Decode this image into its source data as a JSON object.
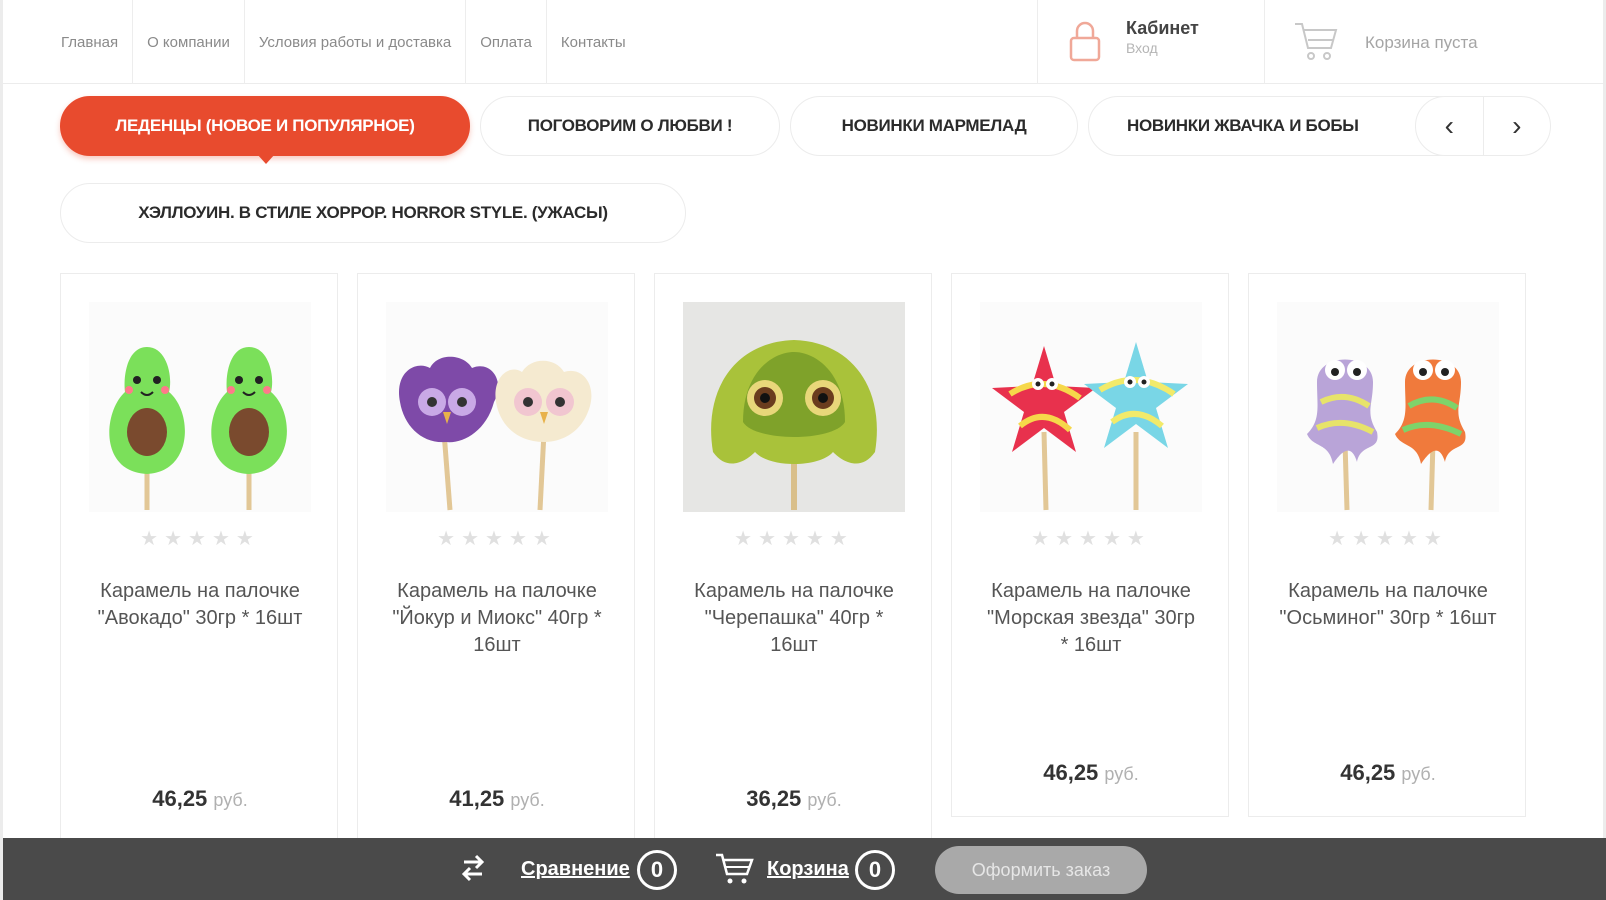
{
  "nav": [
    "Главная",
    "О компании",
    "Условия работы и доставка",
    "Оплата",
    "Контакты"
  ],
  "cabinet": {
    "title": "Кабинет",
    "sub": "Вход"
  },
  "cart_header": {
    "text": "Корзина пуста"
  },
  "tabs": [
    "ЛЕДЕНЦЫ (НОВОЕ И ПОПУЛЯРНОЕ)",
    "ПОГОВОРИМ О ЛЮБВИ !",
    "НОВИНКИ МАРМЕЛАД",
    "НОВИНКИ ЖВАЧКА И БОБЫ"
  ],
  "tab_second": "ХЭЛЛОУИН. В СТИЛЕ ХОРРОР. HORROR STYLE. (УЖАСЫ)",
  "arrows": {
    "prev": "‹",
    "next": "›"
  },
  "products": [
    {
      "name": "Карамель на палочке \"Авокадо\" 30гр * 16шт",
      "price": "46,25",
      "currency": "руб.",
      "stars": "★★★★★",
      "image": "avocado-lollipops"
    },
    {
      "name": "Карамель на палочке \"Йокур и Миокс\" 40гр * 16шт",
      "price": "41,25",
      "currency": "руб.",
      "stars": "★★★★★",
      "image": "owl-lollipops"
    },
    {
      "name": "Карамель на палочке \"Черепашка\" 40гр * 16шт",
      "price": "36,25",
      "currency": "руб.",
      "stars": "★★★★★",
      "image": "turtle-lollipop"
    },
    {
      "name": "Карамель на палочке \"Морская звезда\" 30гр * 16шт",
      "price": "46,25",
      "currency": "руб.",
      "stars": "★★★★★",
      "image": "starfish-lollipops"
    },
    {
      "name": "Карамель на палочке \"Осьминог\" 30гр * 16шт",
      "price": "46,25",
      "currency": "руб.",
      "stars": "★★★★★",
      "image": "octopus-lollipops"
    }
  ],
  "bottombar": {
    "compare_label": "Сравнение",
    "compare_count": "0",
    "cart_label": "Корзина",
    "cart_count": "0",
    "order_label": "Оформить заказ"
  },
  "colors": {
    "accent": "#e84b2e",
    "bar": "#4a4a4a"
  }
}
